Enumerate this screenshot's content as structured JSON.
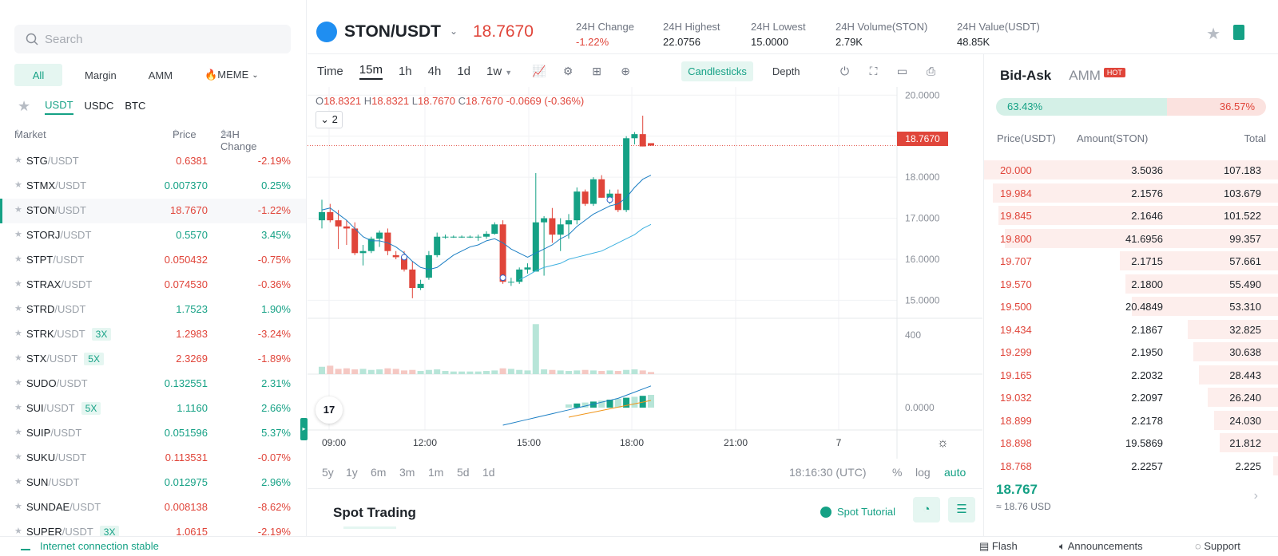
{
  "search": {
    "placeholder": "Search"
  },
  "category_tabs": [
    "All",
    "Margin",
    "AMM",
    "🔥MEME"
  ],
  "quote_tabs": [
    "USDT",
    "USDC",
    "BTC"
  ],
  "market_header": {
    "market": "Market",
    "price": "Price",
    "change": "24H Change"
  },
  "markets": [
    {
      "base": "STG",
      "quote": "/USDT",
      "lev": "",
      "price": "0.6381",
      "change": "-2.19%",
      "dir": "down"
    },
    {
      "base": "STMX",
      "quote": "/USDT",
      "lev": "",
      "price": "0.007370",
      "change": "0.25%",
      "dir": "up"
    },
    {
      "base": "STON",
      "quote": "/USDT",
      "lev": "",
      "price": "18.7670",
      "change": "-1.22%",
      "dir": "down",
      "selected": true
    },
    {
      "base": "STORJ",
      "quote": "/USDT",
      "lev": "",
      "price": "0.5570",
      "change": "3.45%",
      "dir": "up"
    },
    {
      "base": "STPT",
      "quote": "/USDT",
      "lev": "",
      "price": "0.050432",
      "change": "-0.75%",
      "dir": "down"
    },
    {
      "base": "STRAX",
      "quote": "/USDT",
      "lev": "",
      "price": "0.074530",
      "change": "-0.36%",
      "dir": "down"
    },
    {
      "base": "STRD",
      "quote": "/USDT",
      "lev": "",
      "price": "1.7523",
      "change": "1.90%",
      "dir": "up"
    },
    {
      "base": "STRK",
      "quote": "/USDT",
      "lev": "3X",
      "price": "1.2983",
      "change": "-3.24%",
      "dir": "down"
    },
    {
      "base": "STX",
      "quote": "/USDT",
      "lev": "5X",
      "price": "2.3269",
      "change": "-1.89%",
      "dir": "down"
    },
    {
      "base": "SUDO",
      "quote": "/USDT",
      "lev": "",
      "price": "0.132551",
      "change": "2.31%",
      "dir": "up"
    },
    {
      "base": "SUI",
      "quote": "/USDT",
      "lev": "5X",
      "price": "1.1160",
      "change": "2.66%",
      "dir": "up"
    },
    {
      "base": "SUIP",
      "quote": "/USDT",
      "lev": "",
      "price": "0.051596",
      "change": "5.37%",
      "dir": "up"
    },
    {
      "base": "SUKU",
      "quote": "/USDT",
      "lev": "",
      "price": "0.113531",
      "change": "-0.07%",
      "dir": "down"
    },
    {
      "base": "SUN",
      "quote": "/USDT",
      "lev": "",
      "price": "0.012975",
      "change": "2.96%",
      "dir": "up"
    },
    {
      "base": "SUNDAE",
      "quote": "/USDT",
      "lev": "",
      "price": "0.008138",
      "change": "-8.62%",
      "dir": "down"
    },
    {
      "base": "SUPER",
      "quote": "/USDT",
      "lev": "3X",
      "price": "1.0615",
      "change": "-2.19%",
      "dir": "down"
    }
  ],
  "ticker": {
    "pair": "STON/USDT",
    "last": "18.7670",
    "stats": [
      {
        "label": "24H Change",
        "value": "-1.22%",
        "dir": "down"
      },
      {
        "label": "24H Highest",
        "value": "22.0756",
        "dir": ""
      },
      {
        "label": "24H Lowest",
        "value": "15.0000",
        "dir": ""
      },
      {
        "label": "24H Volume(STON)",
        "value": "2.79K",
        "dir": ""
      },
      {
        "label": "24H Value(USDT)",
        "value": "48.85K",
        "dir": ""
      }
    ]
  },
  "chart_toolbar": {
    "timeframes": [
      "Time",
      "15m",
      "1h",
      "4h",
      "1d",
      "1w"
    ],
    "active_tf": "15m",
    "views": [
      "Candlesticks",
      "Depth"
    ]
  },
  "chart": {
    "ohlc": {
      "o": "18.8321",
      "h": "18.8321",
      "l": "18.7670",
      "c": "18.7670",
      "chg": "-0.0669",
      "pct": "(-0.36%)"
    },
    "indicator_count": "2",
    "price_ticks": [
      "20.0000",
      "19.0000",
      "18.0000",
      "17.0000",
      "16.0000",
      "15.0000"
    ],
    "volume_tick": "400",
    "macd_tick": "0.0000",
    "time_ticks": [
      "09:00",
      "12:00",
      "15:00",
      "18:00",
      "21:00",
      "7"
    ],
    "last_price_tag": "18.7670",
    "tv_logo": "17",
    "ranges": [
      "5y",
      "1y",
      "6m",
      "3m",
      "1m",
      "5d",
      "1d"
    ],
    "clock": "18:16:30 (UTC)",
    "scale_opts": [
      "%",
      "log",
      "auto"
    ]
  },
  "chart_data": {
    "type": "candlestick",
    "candles": [
      {
        "o": 16.95,
        "h": 17.45,
        "l": 16.75,
        "c": 17.15
      },
      {
        "o": 17.15,
        "h": 17.35,
        "l": 16.9,
        "c": 16.95
      },
      {
        "o": 16.95,
        "h": 17.2,
        "l": 16.25,
        "c": 16.8
      },
      {
        "o": 16.8,
        "h": 16.95,
        "l": 16.35,
        "c": 16.75
      },
      {
        "o": 16.75,
        "h": 16.9,
        "l": 16.1,
        "c": 16.15
      },
      {
        "o": 16.15,
        "h": 16.35,
        "l": 15.85,
        "c": 16.2
      },
      {
        "o": 16.2,
        "h": 16.55,
        "l": 16.15,
        "c": 16.5
      },
      {
        "o": 16.5,
        "h": 16.7,
        "l": 16.3,
        "c": 16.65
      },
      {
        "o": 16.65,
        "h": 16.75,
        "l": 16.1,
        "c": 16.2
      },
      {
        "o": 16.1,
        "h": 16.2,
        "l": 16.0,
        "c": 16.05
      },
      {
        "o": 16.05,
        "h": 16.2,
        "l": 15.7,
        "c": 15.75
      },
      {
        "o": 15.75,
        "h": 15.95,
        "l": 15.05,
        "c": 15.3
      },
      {
        "o": 15.3,
        "h": 15.5,
        "l": 15.25,
        "c": 15.4
      },
      {
        "o": 15.55,
        "h": 16.2,
        "l": 15.5,
        "c": 16.1
      },
      {
        "o": 16.1,
        "h": 16.65,
        "l": 16.05,
        "c": 16.55
      },
      {
        "o": 16.55,
        "h": 16.6,
        "l": 16.5,
        "c": 16.55
      },
      {
        "o": 16.55,
        "h": 16.58,
        "l": 16.52,
        "c": 16.55
      },
      {
        "o": 16.55,
        "h": 16.58,
        "l": 16.52,
        "c": 16.55
      },
      {
        "o": 16.55,
        "h": 16.58,
        "l": 16.52,
        "c": 16.55
      },
      {
        "o": 16.55,
        "h": 16.6,
        "l": 16.45,
        "c": 16.55
      },
      {
        "o": 16.55,
        "h": 16.68,
        "l": 16.5,
        "c": 16.62
      },
      {
        "o": 16.62,
        "h": 16.9,
        "l": 16.6,
        "c": 16.85
      },
      {
        "o": 16.85,
        "h": 16.95,
        "l": 15.4,
        "c": 15.45
      },
      {
        "o": 15.45,
        "h": 15.55,
        "l": 15.35,
        "c": 15.45
      },
      {
        "o": 15.45,
        "h": 15.8,
        "l": 15.4,
        "c": 15.75
      },
      {
        "o": 15.75,
        "h": 15.9,
        "l": 15.65,
        "c": 15.8
      },
      {
        "o": 15.7,
        "h": 18.1,
        "l": 15.7,
        "c": 16.9
      },
      {
        "o": 16.9,
        "h": 17.05,
        "l": 15.6,
        "c": 17.0
      },
      {
        "o": 17.0,
        "h": 17.25,
        "l": 16.4,
        "c": 16.6
      },
      {
        "o": 16.6,
        "h": 17.0,
        "l": 16.2,
        "c": 16.85
      },
      {
        "o": 16.85,
        "h": 17.1,
        "l": 16.5,
        "c": 16.95
      },
      {
        "o": 16.95,
        "h": 17.75,
        "l": 16.85,
        "c": 17.65
      },
      {
        "o": 17.65,
        "h": 17.7,
        "l": 17.3,
        "c": 17.35
      },
      {
        "o": 17.35,
        "h": 18.0,
        "l": 17.3,
        "c": 17.95
      },
      {
        "o": 17.95,
        "h": 18.05,
        "l": 17.5,
        "c": 17.5
      },
      {
        "o": 17.5,
        "h": 17.7,
        "l": 17.35,
        "c": 17.6
      },
      {
        "o": 17.6,
        "h": 17.7,
        "l": 17.15,
        "c": 17.2
      },
      {
        "o": 17.2,
        "h": 19.0,
        "l": 17.15,
        "c": 18.95
      },
      {
        "o": 18.95,
        "h": 19.1,
        "l": 18.8,
        "c": 19.05
      },
      {
        "o": 19.05,
        "h": 19.5,
        "l": 18.75,
        "c": 18.75
      },
      {
        "o": 18.83,
        "h": 18.83,
        "l": 18.77,
        "c": 18.77
      }
    ],
    "volumes": [
      28,
      32,
      20,
      22,
      18,
      20,
      16,
      18,
      22,
      20,
      14,
      16,
      12,
      16,
      18,
      12,
      10,
      10,
      10,
      10,
      12,
      14,
      22,
      20,
      16,
      14,
      190,
      18,
      16,
      14,
      12,
      14,
      16,
      14,
      12,
      14,
      12,
      16,
      18,
      14,
      8
    ],
    "ma_fast": [
      17.2,
      17.25,
      17.1,
      16.95,
      16.75,
      16.55,
      16.45,
      16.45,
      16.4,
      16.3,
      16.15,
      15.95,
      15.8,
      15.75,
      15.8,
      15.95,
      16.1,
      16.2,
      16.3,
      16.35,
      16.45,
      16.5,
      16.4,
      16.25,
      16.15,
      16.05,
      16.15,
      16.25,
      16.35,
      16.5,
      16.6,
      16.8,
      16.95,
      17.1,
      17.2,
      17.3,
      17.35,
      17.5,
      17.75,
      17.95,
      18.05
    ],
    "ma_slow": [
      null,
      null,
      null,
      null,
      null,
      null,
      null,
      null,
      null,
      null,
      null,
      null,
      null,
      null,
      null,
      null,
      null,
      null,
      null,
      null,
      null,
      null,
      null,
      null,
      15.5,
      15.6,
      15.72,
      15.8,
      15.85,
      15.9,
      16.0,
      16.05,
      16.1,
      16.15,
      16.2,
      16.3,
      16.4,
      16.5,
      16.6,
      16.75,
      16.85
    ],
    "ylim": [
      14.6,
      20.2
    ]
  },
  "book": {
    "tabs": [
      "Bid-Ask",
      "AMM"
    ],
    "hot": "HOT",
    "buy_pct": "63.43%",
    "sell_pct": "36.57%",
    "buy_ratio": 0.6343,
    "header": {
      "price": "Price(USDT)",
      "amount": "Amount(STON)",
      "total": "Total"
    },
    "asks": [
      {
        "price": "20.000",
        "amount": "3.5036",
        "total": "107.183",
        "depth": 1.0
      },
      {
        "price": "19.984",
        "amount": "2.1576",
        "total": "103.679",
        "depth": 0.97
      },
      {
        "price": "19.845",
        "amount": "2.1646",
        "total": "101.522",
        "depth": 0.95
      },
      {
        "price": "19.800",
        "amount": "41.6956",
        "total": "99.357",
        "depth": 0.93
      },
      {
        "price": "19.707",
        "amount": "2.1715",
        "total": "57.661",
        "depth": 0.54
      },
      {
        "price": "19.570",
        "amount": "2.1800",
        "total": "55.490",
        "depth": 0.52
      },
      {
        "price": "19.500",
        "amount": "20.4849",
        "total": "53.310",
        "depth": 0.5
      },
      {
        "price": "19.434",
        "amount": "2.1867",
        "total": "32.825",
        "depth": 0.31
      },
      {
        "price": "19.299",
        "amount": "2.1950",
        "total": "30.638",
        "depth": 0.29
      },
      {
        "price": "19.165",
        "amount": "2.2032",
        "total": "28.443",
        "depth": 0.27
      },
      {
        "price": "19.032",
        "amount": "2.2097",
        "total": "26.240",
        "depth": 0.24
      },
      {
        "price": "18.899",
        "amount": "2.2178",
        "total": "24.030",
        "depth": 0.22
      },
      {
        "price": "18.898",
        "amount": "19.5869",
        "total": "21.812",
        "depth": 0.2
      },
      {
        "price": "18.768",
        "amount": "2.2257",
        "total": "2.225",
        "depth": 0.02
      }
    ],
    "mid_price": "18.767",
    "mid_usd": "≈ 18.76 USD"
  },
  "spot": {
    "title": "Spot Trading",
    "tutorial": "Spot Tutorial"
  },
  "footer": {
    "connection": "Internet connection stable",
    "flash": "Flash",
    "announcements": "Announcements",
    "support": "Support"
  },
  "colors": {
    "up": "#15a185",
    "down": "#e0453a",
    "accent": "#15a185"
  }
}
